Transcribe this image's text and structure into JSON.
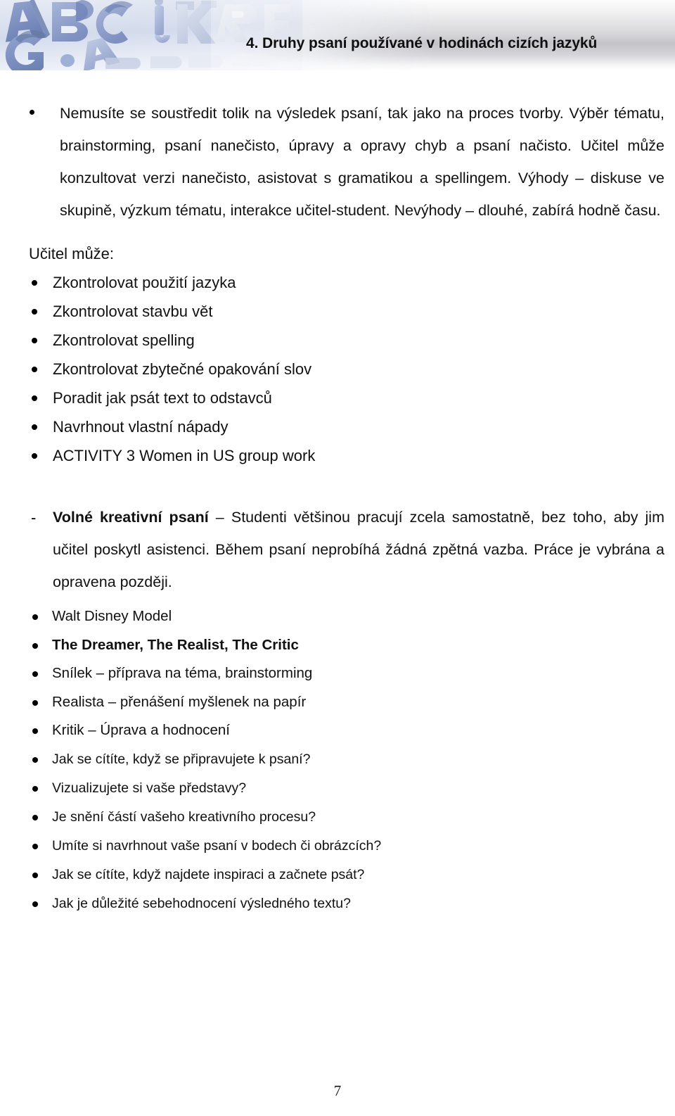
{
  "header": {
    "title": "4. Druhy psaní používané v hodinách cizích jazyků",
    "decoration_icon": "alphabet-letter-blocks-photo"
  },
  "content": {
    "intro_paragraph": "Nemusíte se soustředit tolik na výsledek psaní, tak jako na proces tvorby. Výběr tématu, brainstorming, psaní nanečisto, úpravy a opravy chyb a psaní načisto. Učitel může konzultovat verzi nanečisto, asistovat s gramatikou a spellingem. Výhody – diskuse ve skupině, výzkum tématu, interakce učitel-student. Nevýhody – dlouhé, zabírá hodně času.",
    "teacher_heading": "Učitel může:",
    "teacher_items": [
      "Zkontrolovat použití jazyka",
      "Zkontrolovat stavbu vět",
      "Zkontrolovat spelling",
      "Zkontrolovat zbytečné opakování slov",
      "Poradit jak psát text to odstavců",
      "Navrhnout vlastní nápady",
      "ACTIVITY 3 Women in US group work"
    ],
    "free_writing": {
      "marker": "-",
      "term": "Volné kreativní psaní",
      "body": " – Studenti většinou pracují zcela samostatně, bez toho, aby jim učitel poskytl asistenci. Během psaní neprobíhá žádná zpětná vazba. Práce je vybrána a opravena později."
    },
    "disney_items": [
      {
        "label": "Walt Disney Model",
        "bold": false
      },
      {
        "label": "The Dreamer,  The Realist, The Critic",
        "bold": true
      },
      {
        "label": "Snílek – příprava na téma, brainstorming",
        "bold": false
      },
      {
        "label": "Realista – přenášení myšlenek na papír",
        "bold": false
      },
      {
        "label": "Kritik – Úprava a hodnocení",
        "bold": false
      }
    ],
    "question_items": [
      "Jak se cítíte, když se připravujete k psaní?",
      "Vizualizujete si vaše představy?",
      "Je snění částí vašeho kreativního procesu?",
      "Umíte si navrhnout vaše psaní v bodech či obrázcích?",
      "Jak se cítíte, když najdete inspiraci a začnete psát?",
      "Jak je důležité sebehodnocení výsledného textu?"
    ]
  },
  "footer": {
    "page_number": "7"
  },
  "colors": {
    "text": "#111111",
    "banner_gray": "#c4c4c8",
    "letter_blue": "#8e9dc8"
  }
}
